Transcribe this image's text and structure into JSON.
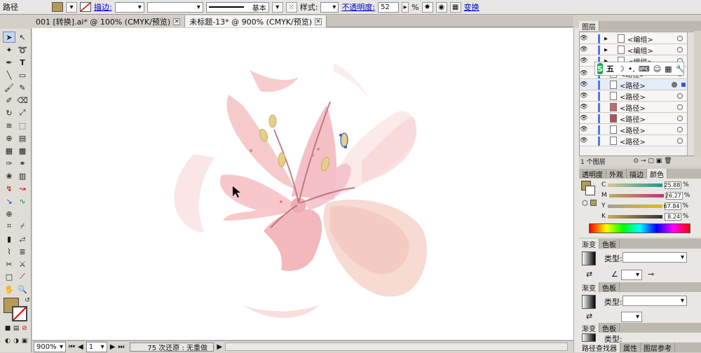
{
  "control_bar": {
    "object_type": "路径",
    "stroke_label": "描边:",
    "stroke_style": "基本",
    "style_label": "样式:",
    "opacity_label": "不透明度:",
    "opacity_value": "52",
    "percent": "%",
    "transform_label": "变换"
  },
  "tabs": [
    {
      "label": "001 [转换].ai* @ 100% (CMYK/预览)"
    },
    {
      "label": "未标题-13* @ 900% (CMYK/预览)"
    }
  ],
  "status_bar": {
    "zoom": "900%",
    "page": "1",
    "message": "75 次还原 : 无重做"
  },
  "layers_panel": {
    "title": "图层",
    "items": [
      {
        "label": "<编组>",
        "kind": "group"
      },
      {
        "label": "<编组>",
        "kind": "group"
      },
      {
        "label": "<编组>",
        "kind": "group"
      },
      {
        "label": "<路径>",
        "kind": "path"
      },
      {
        "label": "<路径>",
        "kind": "path"
      },
      {
        "label": "<路径>",
        "kind": "path"
      },
      {
        "label": "<路径>",
        "kind": "path"
      },
      {
        "label": "<路径>",
        "kind": "path"
      },
      {
        "label": "<路径>",
        "kind": "path"
      },
      {
        "label": "<路径>",
        "kind": "path"
      }
    ],
    "footer": "1 个图层"
  },
  "ime_toolbar": {
    "mode": "五",
    "logo": "S"
  },
  "color_panel": {
    "tabs": [
      "透明度",
      "外观",
      "描边",
      "颜色"
    ],
    "active_tab": "颜色",
    "channels": [
      {
        "name": "C",
        "value": "25.88",
        "color": "#1a9c8c",
        "fraction": 0.26
      },
      {
        "name": "M",
        "value": "26.27",
        "color": "#c8307a",
        "fraction": 0.26
      },
      {
        "name": "Y",
        "value": "67.84",
        "color": "#d8c020",
        "fraction": 0.68
      },
      {
        "name": "K",
        "value": "8.24",
        "color": "#333333",
        "fraction": 0.08
      }
    ],
    "unit": "%"
  },
  "gradient_panels": [
    {
      "tabs": [
        "渐变",
        "色板"
      ],
      "type_label": "类型:"
    },
    {
      "tabs": [
        "渐变",
        "色板"
      ],
      "type_label": "类型:"
    },
    {
      "tabs": [
        "渐变",
        "色板"
      ],
      "type_label": "类型:"
    }
  ],
  "bottom_panel_tabs": [
    "路径查找器",
    "属性",
    "图层参考"
  ],
  "colors": {
    "fill": "#b59a55",
    "petal_pink": "#f2b7b4",
    "petal_deep": "#e79a9e",
    "stamen": "#e6cf86",
    "accent_blue": "#2f5bd6"
  }
}
